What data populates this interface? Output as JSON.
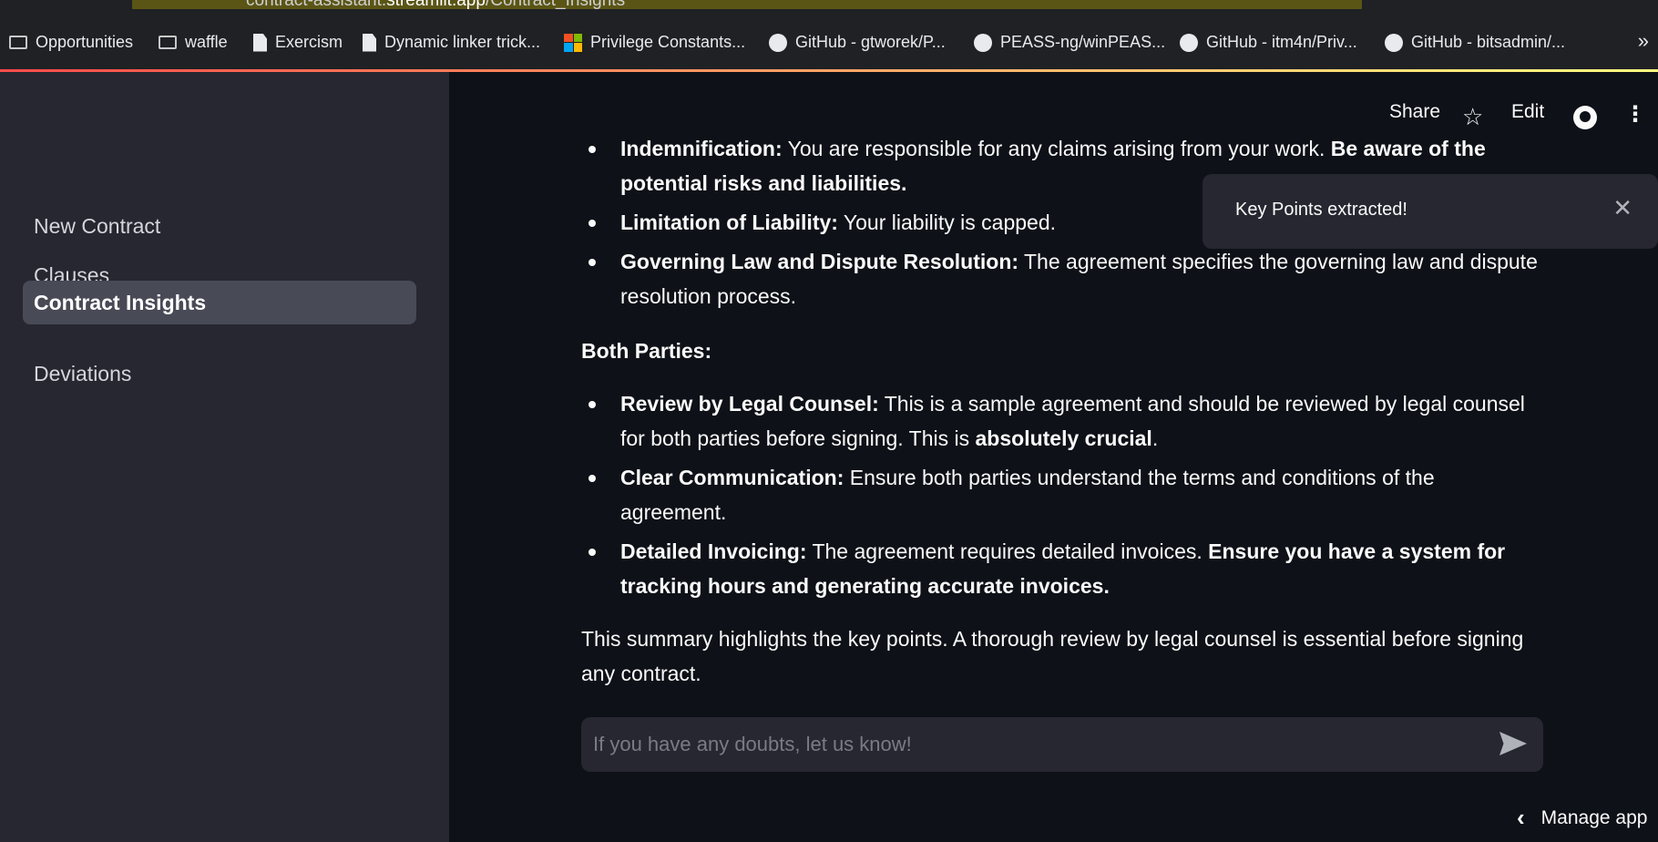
{
  "browser": {
    "url_prefix": "contract-assistant.",
    "url_host": "streamlit.app",
    "url_path": "/Contract_Insights"
  },
  "bookmarks": [
    {
      "label": "Opportunities",
      "icon": "folder-icon"
    },
    {
      "label": "waffle",
      "icon": "folder-icon"
    },
    {
      "label": "Exercism",
      "icon": "file-icon"
    },
    {
      "label": "Dynamic linker trick...",
      "icon": "file-icon"
    },
    {
      "label": "Privilege Constants...",
      "icon": "microsoft-icon"
    },
    {
      "label": "GitHub - gtworek/P...",
      "icon": "github-icon"
    },
    {
      "label": "PEASS-ng/winPEAS...",
      "icon": "github-icon"
    },
    {
      "label": "GitHub - itm4n/Priv...",
      "icon": "github-icon"
    },
    {
      "label": "GitHub - bitsadmin/...",
      "icon": "github-icon"
    }
  ],
  "sidebar": {
    "items": [
      {
        "label": "New Contract",
        "active": false
      },
      {
        "label": "Clauses",
        "active": false
      },
      {
        "label": "Contract Insights",
        "active": true
      },
      {
        "label": "Deviations",
        "active": false
      }
    ]
  },
  "toolbar": {
    "share_label": "Share",
    "edit_label": "Edit",
    "star_icon": "star-icon",
    "github_icon": "github-icon",
    "menu_icon": "kebab-menu-icon"
  },
  "content": {
    "top_list": [
      {
        "title": "Indemnification:",
        "text": " You are responsible for any claims arising from your work. ",
        "emph": "Be aware of the potential risks and liabilities."
      },
      {
        "title": "Limitation of Liability:",
        "text": " Your liability is capped.",
        "emph": ""
      },
      {
        "title": "Governing Law and Dispute Resolution:",
        "text": " The agreement specifies the governing law and dispute resolution process.",
        "emph": ""
      }
    ],
    "both_parties_heading": "Both Parties:",
    "both_list": [
      {
        "title": "Review by Legal Counsel:",
        "text": " This is a sample agreement and should be reviewed by legal counsel for both parties before signing. This is ",
        "emph": "absolutely crucial",
        "tail": "."
      },
      {
        "title": "Clear Communication:",
        "text": " Ensure both parties understand the terms and conditions of the agreement.",
        "emph": "",
        "tail": ""
      },
      {
        "title": "Detailed Invoicing:",
        "text": " The agreement requires detailed invoices. ",
        "emph": "Ensure you have a system for tracking hours and generating accurate invoices.",
        "tail": ""
      }
    ],
    "summary": "This summary highlights the key points. A thorough review by legal counsel is essential before signing any contract."
  },
  "toast": {
    "message": "Key Points extracted!",
    "close_glyph": "✕"
  },
  "chat": {
    "placeholder": "If you have any doubts, let us know!"
  },
  "manage": {
    "label": "Manage app",
    "chevron": "‹"
  }
}
